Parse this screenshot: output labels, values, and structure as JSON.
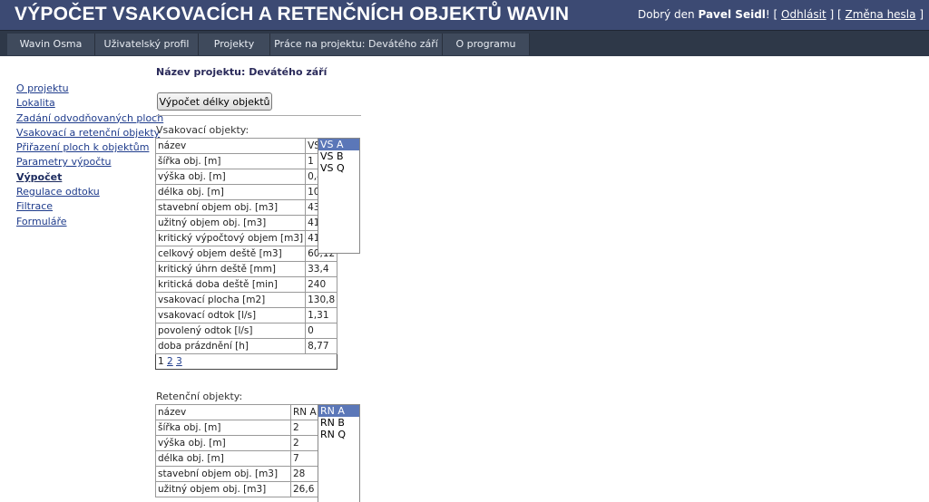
{
  "header": {
    "title": "VÝPOČET VSAKOVACÍCH A RETENČNÍCH OBJEKTŮ WAVIN",
    "greeting": "Dobrý den",
    "user_name": "Pavel Seidl",
    "logout_label": "Odhlásit",
    "change_password_label": "Změna hesla"
  },
  "nav": {
    "items": [
      {
        "label": "Wavin Osma"
      },
      {
        "label": "Uživatelský profil"
      },
      {
        "label": "Projekty"
      },
      {
        "label": "Práce na projektu: Devátého září"
      },
      {
        "label": "O programu"
      }
    ]
  },
  "sidebar": {
    "items": [
      {
        "label": "O projektu"
      },
      {
        "label": "Lokalita"
      },
      {
        "label": "Zadání odvodňovaných ploch"
      },
      {
        "label": "Vsakovací a retenční objekty"
      },
      {
        "label": "Přiřazení ploch k objektům"
      },
      {
        "label": "Parametry výpočtu"
      },
      {
        "label": "Výpočet",
        "active": true
      },
      {
        "label": "Regulace odtoku"
      },
      {
        "label": "Filtrace"
      },
      {
        "label": "Formuláře"
      }
    ]
  },
  "main": {
    "project_title": "Název projektu: Devátého září",
    "calc_button_label": "Výpočet délky objektů",
    "infiltration": {
      "section_label": "Vsakovací objekty:",
      "rows": [
        [
          "název",
          "VS A"
        ],
        [
          "šířka obj. [m]",
          "1"
        ],
        [
          "výška obj. [m]",
          "0,4"
        ],
        [
          "délka obj. [m]",
          "109"
        ],
        [
          "stavební objem obj. [m3]",
          "43,6"
        ],
        [
          "užitný objem obj. [m3]",
          "41,42"
        ],
        [
          "kritický výpočtový objem [m3]",
          "41,28"
        ],
        [
          "celkový objem deště [m3]",
          "60,12"
        ],
        [
          "kritický úhrn deště [mm]",
          "33,4"
        ],
        [
          "kritická doba deště [min]",
          "240"
        ],
        [
          "vsakovací plocha [m2]",
          "130,8"
        ],
        [
          "vsakovací odtok [l/s]",
          "1,31"
        ],
        [
          "povolený odtok [l/s]",
          "0"
        ],
        [
          "doba prázdnění [h]",
          "8,77"
        ]
      ],
      "pager": {
        "current": "1",
        "pages": [
          "2",
          "3"
        ]
      },
      "list_options": [
        "VS A",
        "VS B",
        "VS Q"
      ],
      "selected_option": "VS A"
    },
    "retention": {
      "section_label": "Retenční objekty:",
      "rows": [
        [
          "název",
          "RN A"
        ],
        [
          "šířka obj. [m]",
          "2"
        ],
        [
          "výška obj. [m]",
          "2"
        ],
        [
          "délka obj. [m]",
          "7"
        ],
        [
          "stavební objem obj. [m3]",
          "28"
        ],
        [
          "užitný objem obj. [m3]",
          "26,6"
        ]
      ],
      "list_options": [
        "RN A",
        "RN B",
        "RN Q"
      ],
      "selected_option": "RN A"
    }
  },
  "colors": {
    "header_bg": "#3c4a73",
    "nav_bg": "#2e3848",
    "nav_item_bg": "#3f4a5c",
    "link": "#1f3c8c",
    "list_selected": "#5b77b8"
  }
}
